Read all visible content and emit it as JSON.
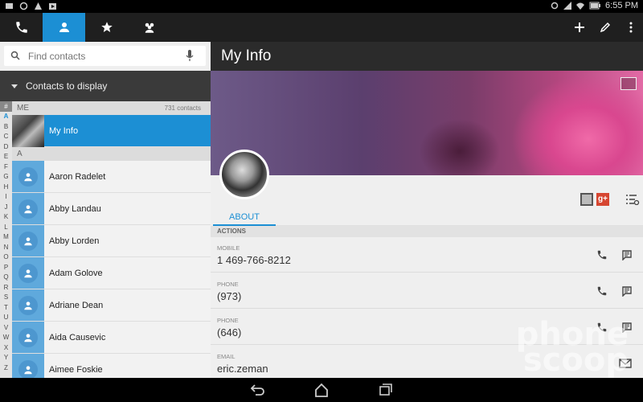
{
  "status": {
    "time": "6:55 PM"
  },
  "tabs": [
    {
      "name": "tab-phone",
      "icon": "phone-icon"
    },
    {
      "name": "tab-contacts",
      "icon": "person-icon"
    },
    {
      "name": "tab-favorites",
      "icon": "star-icon"
    },
    {
      "name": "tab-groups",
      "icon": "group-icon"
    }
  ],
  "search": {
    "placeholder": "Find contacts"
  },
  "filter": {
    "label": "Contacts to display"
  },
  "alphabet": [
    "A",
    "B",
    "C",
    "D",
    "E",
    "F",
    "G",
    "H",
    "I",
    "J",
    "K",
    "L",
    "M",
    "N",
    "O",
    "P",
    "Q",
    "R",
    "S",
    "T",
    "U",
    "V",
    "W",
    "X",
    "Y",
    "Z"
  ],
  "list": {
    "me_section": "ME",
    "contact_count": "731 contacts",
    "my_info": "My Info",
    "a_section": "A",
    "contacts": [
      "Aaron Radelet",
      "Abby Landau",
      "Abby Lorden",
      "Adam Golove",
      "Adriane Dean",
      "Aida Causevic",
      "Aimee Foskie"
    ]
  },
  "detail": {
    "title": "My Info",
    "tab_about": "ABOUT",
    "actions_header": "ACTIONS",
    "entries": [
      {
        "type": "MOBILE",
        "value": "1 469-766-8212"
      },
      {
        "type": "PHONE",
        "value": "(973)"
      },
      {
        "type": "PHONE",
        "value": "(646)"
      },
      {
        "type": "EMAIL",
        "value": "eric.zeman"
      }
    ],
    "gplus": "g+"
  },
  "watermark": {
    "line1": "phone",
    "line2": "scoop"
  },
  "colors": {
    "accent": "#1c8fd4",
    "actionbar": "#1f1f1f",
    "gplus": "#d64631"
  }
}
